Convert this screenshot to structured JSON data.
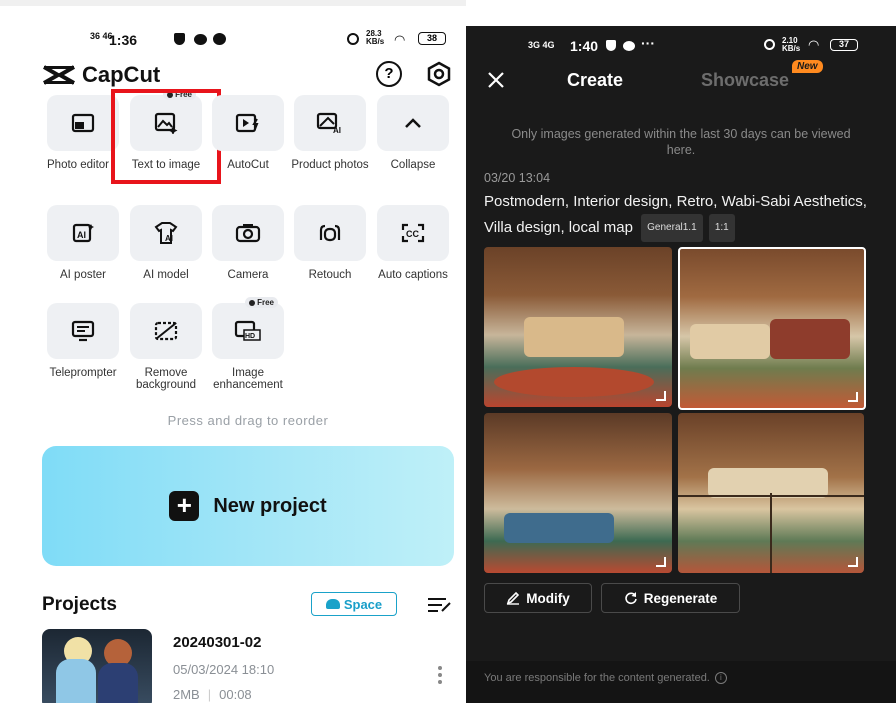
{
  "left": {
    "status": {
      "net": "36 46",
      "time": "1:36",
      "speed": "28.3 KB/s",
      "battery": "38"
    },
    "brand": "CapCut",
    "tools_row1": [
      {
        "label": "Photo editor",
        "icon": "photo-edit-icon"
      },
      {
        "label": "Text to image",
        "icon": "text-to-image-icon",
        "badge": "Free"
      },
      {
        "label": "AutoCut",
        "icon": "autocut-icon"
      },
      {
        "label": "Product photos",
        "icon": "product-photos-icon"
      },
      {
        "label": "Collapse",
        "icon": "chevron-up-icon"
      }
    ],
    "tools_row2": [
      {
        "label": "AI poster"
      },
      {
        "label": "AI model"
      },
      {
        "label": "Camera"
      },
      {
        "label": "Retouch"
      },
      {
        "label": "Auto captions"
      }
    ],
    "tools_row3": [
      {
        "label": "Teleprompter"
      },
      {
        "label": "Remove background"
      },
      {
        "label": "Image enhancement",
        "badge": "Free"
      }
    ],
    "reorder_hint": "Press and drag to reorder",
    "new_project": "New project",
    "projects_title": "Projects",
    "space_label": "Space",
    "project": {
      "name": "20240301-02",
      "date": "05/03/2024 18:10",
      "size": "2MB",
      "duration": "00:08"
    },
    "highlight_color": "#e8141b"
  },
  "right": {
    "status": {
      "net": "3G 4G",
      "time": "1:40",
      "speed": "2.10 KB/s",
      "battery": "37"
    },
    "tab_create": "Create",
    "tab_showcase": "Showcase",
    "new_badge": "New",
    "notice": "Only images generated within the last 30 days can be viewed here.",
    "timestamp": "03/20 13:04",
    "prompt": "Postmodern, Interior design, Retro, Wabi-Sabi Aesthetics, Villa design, local map",
    "tag_model": "General1.1",
    "tag_ratio": "1:1",
    "modify_label": "Modify",
    "regenerate_label": "Regenerate",
    "disclaimer": "You are responsible for the content generated."
  }
}
